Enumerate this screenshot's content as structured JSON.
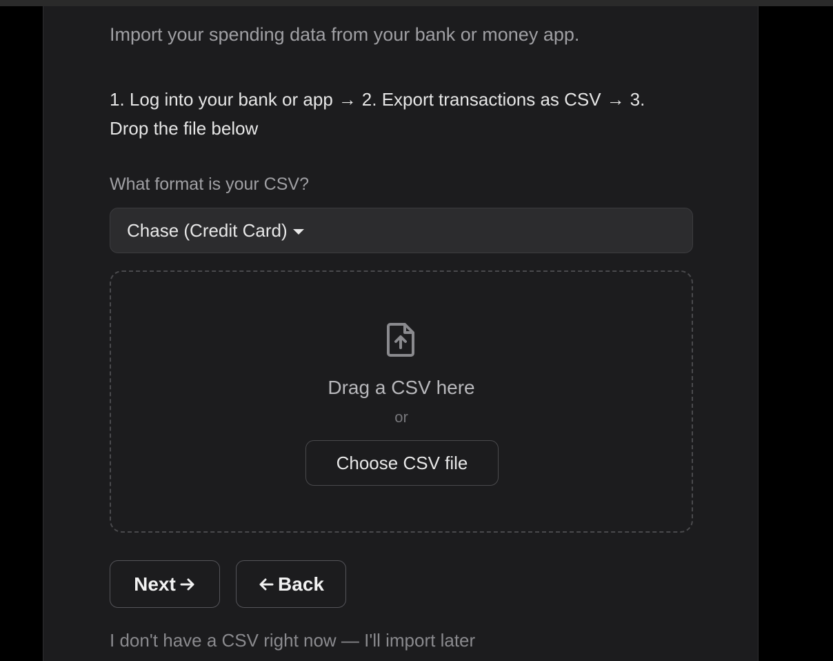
{
  "heading": "",
  "subtitle": "Import your spending data from your bank or money app.",
  "steps": {
    "step1": "1. Log into your bank or app",
    "step2": "2. Export transactions as CSV",
    "step3": "3. Drop the file below"
  },
  "format": {
    "label": "What format is your CSV?",
    "selected": "Chase (Credit Card)"
  },
  "dropzone": {
    "icon": "file-upload-icon",
    "title": "Drag a CSV here",
    "or": "or",
    "choose_label": "Choose CSV file"
  },
  "actions": {
    "next_label": "Next",
    "back_label": "Back"
  },
  "later_link": "I don't have a CSV right now — I'll import later",
  "colors": {
    "background": "#000000",
    "card": "#1c1c1e",
    "input": "#2c2c2e",
    "text": "#e8e8e8",
    "muted": "#a0a0a4"
  }
}
